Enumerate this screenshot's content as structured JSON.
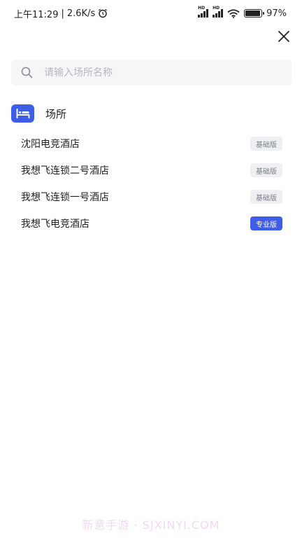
{
  "status_bar": {
    "time": "上午11:29",
    "speed": "2.6K/s",
    "hd1": "HD",
    "hd2": "HD",
    "battery": "97%"
  },
  "search": {
    "placeholder": "请输入场所名称",
    "value": ""
  },
  "section": {
    "title": "场所"
  },
  "venues": [
    {
      "name": "沈阳电竞酒店",
      "badge": "基础版",
      "tier": "basic"
    },
    {
      "name": "我想飞连锁二号酒店",
      "badge": "基础版",
      "tier": "basic"
    },
    {
      "name": "我想飞连锁一号酒店",
      "badge": "基础版",
      "tier": "basic"
    },
    {
      "name": "我想飞电竞酒店",
      "badge": "专业版",
      "tier": "pro"
    }
  ],
  "watermark": "新意手游 · SJXINYI.COM",
  "colors": {
    "accent": "#3f5ee8",
    "badge_basic_bg": "#eef0f3",
    "search_bg": "#f5f6f8"
  },
  "icons": {
    "search": "search-icon",
    "close": "close-icon",
    "section": "bed-icon",
    "alarm": "alarm-icon",
    "wifi": "wifi-icon",
    "battery": "battery-icon"
  }
}
